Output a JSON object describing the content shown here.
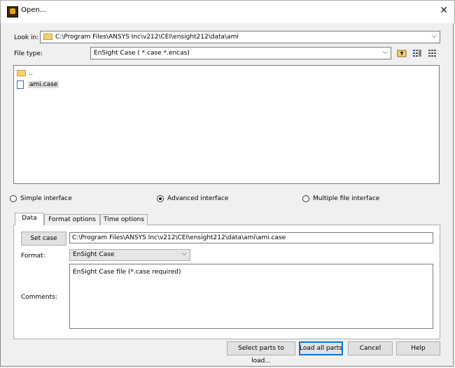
{
  "window": {
    "title": "Open...",
    "close_glyph": "✕"
  },
  "look_in": {
    "label": "Look in:",
    "path": "C:\\Program Files\\ANSYS Inc\\v212\\CEI\\ensight212\\data\\ami"
  },
  "file_type": {
    "label": "File type:",
    "value": "EnSight Case ( *.case *.encas)"
  },
  "toolbar_icons": [
    "up-folder-icon",
    "detail-view-icon",
    "list-view-icon"
  ],
  "files": [
    {
      "name": "..",
      "kind": "folder"
    },
    {
      "name": "ami.case",
      "kind": "file",
      "selected": true
    }
  ],
  "interface": {
    "simple": "Simple interface",
    "advanced": "Advanced interface",
    "multiple": "Multiple file interface",
    "selected": "advanced"
  },
  "tabs": [
    {
      "label": "Data",
      "active": true
    },
    {
      "label": "Format options",
      "active": false
    },
    {
      "label": "Time options",
      "active": false
    }
  ],
  "data_tab": {
    "set_case_label": "Set case",
    "case_path": "C:\\Program Files\\ANSYS Inc\\v212\\CEI\\ensight212\\data\\ami\\ami.case",
    "format_label": "Format:",
    "format_value": "EnSight Case",
    "comments_label": "Comments:",
    "comments_text": "EnSight Case file (*.case required)"
  },
  "buttons": {
    "select_parts": "Select parts to load...",
    "load_all": "Load all parts",
    "cancel": "Cancel",
    "help": "Help"
  },
  "colors": {
    "accent": "#0078d7",
    "folder": "#f5d272"
  }
}
